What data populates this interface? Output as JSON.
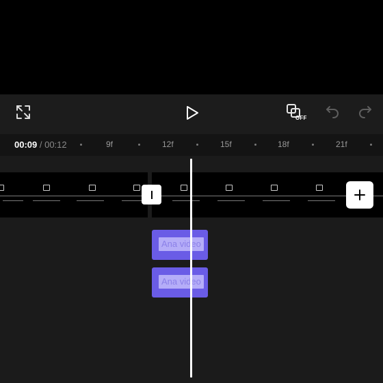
{
  "controls": {
    "fullscreen_icon": "expand-arrows-icon",
    "play_icon": "play-icon",
    "overlay_toggle_icon": "overlay-off-icon",
    "overlay_toggle_badge": "OFF",
    "undo_icon": "undo-icon",
    "redo_icon": "redo-icon"
  },
  "ruler": {
    "current_time": "00:09",
    "separator": " / ",
    "total_time": "00:12",
    "ticks": [
      "9f",
      "12f",
      "15f",
      "18f",
      "21f"
    ]
  },
  "timeline": {
    "transition_icon": "transition-icon",
    "add_clip_icon": "plus-icon",
    "text_tracks": [
      {
        "label": "Ana video"
      },
      {
        "label": "Ana video"
      }
    ]
  },
  "colors": {
    "text_track": "#6a5ce6",
    "background": "#1b1b1b",
    "controls_bar": "#1c1c1c"
  }
}
